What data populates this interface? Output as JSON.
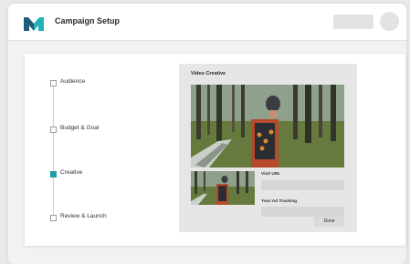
{
  "header": {
    "title": "Campaign Setup",
    "logo_icon": "brand-m-logo-icon",
    "brand_colors": {
      "dark": "#1f5e78",
      "teal": "#21b3b7"
    }
  },
  "steps": [
    {
      "label": "Audience",
      "state": "default"
    },
    {
      "label": "Budget & Goal",
      "state": "default"
    },
    {
      "label": "Creative",
      "state": "active"
    },
    {
      "label": "Review & Launch",
      "state": "default"
    }
  ],
  "active_step_color": "#1ea0a5",
  "creative": {
    "title": "Video Creative",
    "visit_url_label": "Visit URL",
    "visit_url_value": "",
    "ad_tracking_label": "Your Ad Tracking",
    "ad_tracking_value": "",
    "done_label": "Done"
  }
}
